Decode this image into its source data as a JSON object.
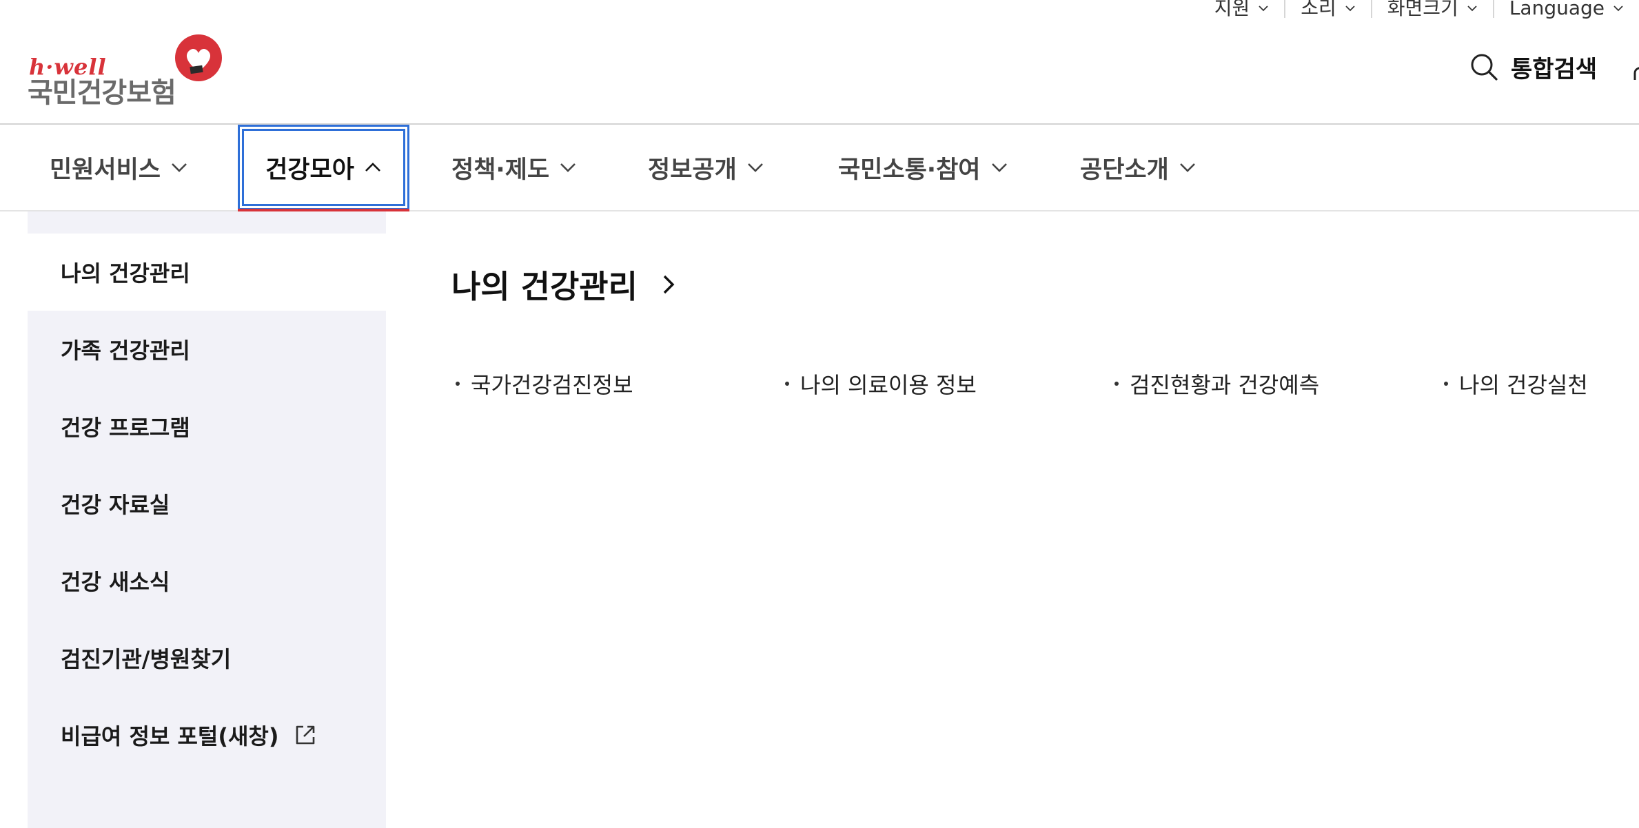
{
  "utility": {
    "items": [
      {
        "label": "지원"
      },
      {
        "label": "소리"
      },
      {
        "label": "화면크기"
      },
      {
        "label": "Language"
      }
    ]
  },
  "header": {
    "logo_tagline": "h·well",
    "logo_name": "국민건강보험",
    "search_label": "통합검색"
  },
  "gnb": {
    "items": [
      {
        "label": "민원서비스"
      },
      {
        "label": "건강모아"
      },
      {
        "label": "정책·제도"
      },
      {
        "label": "정보공개"
      },
      {
        "label": "국민소통·참여"
      },
      {
        "label": "공단소개"
      }
    ],
    "active_index": 1
  },
  "submenu": {
    "items": [
      {
        "label": "나의 건강관리"
      },
      {
        "label": "가족 건강관리"
      },
      {
        "label": "건강 프로그램"
      },
      {
        "label": "건강 자료실"
      },
      {
        "label": "건강 새소식"
      },
      {
        "label": "검진기관/병원찾기"
      },
      {
        "label": "비급여 정보 포털(새창)"
      }
    ],
    "selected_index": 0
  },
  "content": {
    "title": "나의 건강관리",
    "links": [
      {
        "label": "국가건강검진정보"
      },
      {
        "label": "나의 의료이용 정보"
      },
      {
        "label": "검진현황과 건강예측"
      },
      {
        "label": "나의 건강실천"
      }
    ]
  },
  "colors": {
    "brand_red": "#d8333a",
    "focus_blue": "#2e6fd8",
    "submenu_bg": "#f2f2f8"
  }
}
